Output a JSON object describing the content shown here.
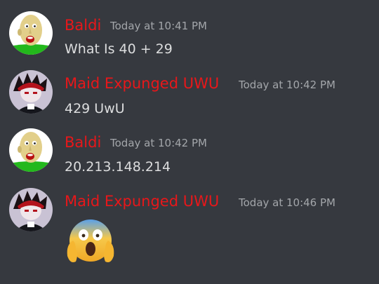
{
  "colors": {
    "background": "#36393f",
    "username": "#e8171a",
    "timestamp": "#a3a6aa",
    "message_text": "#dcddde"
  },
  "messages": [
    {
      "author": "Baldi",
      "timestamp": "Today at 10:41 PM",
      "content": "What Is 40 + 29",
      "avatar_icon": "baldi-avatar"
    },
    {
      "author": "Maid Expunged UWU",
      "timestamp": "Today at 10:42 PM",
      "content": "429 UwU",
      "avatar_icon": "maid-expunged-avatar"
    },
    {
      "author": "Baldi",
      "timestamp": "Today at 10:42 PM",
      "content": "20.213.148.214",
      "avatar_icon": "baldi-avatar"
    },
    {
      "author": "Maid Expunged UWU",
      "timestamp": "Today at 10:46 PM",
      "content": "",
      "emoji": "screaming-in-fear-emoji",
      "avatar_icon": "maid-expunged-avatar"
    }
  ]
}
